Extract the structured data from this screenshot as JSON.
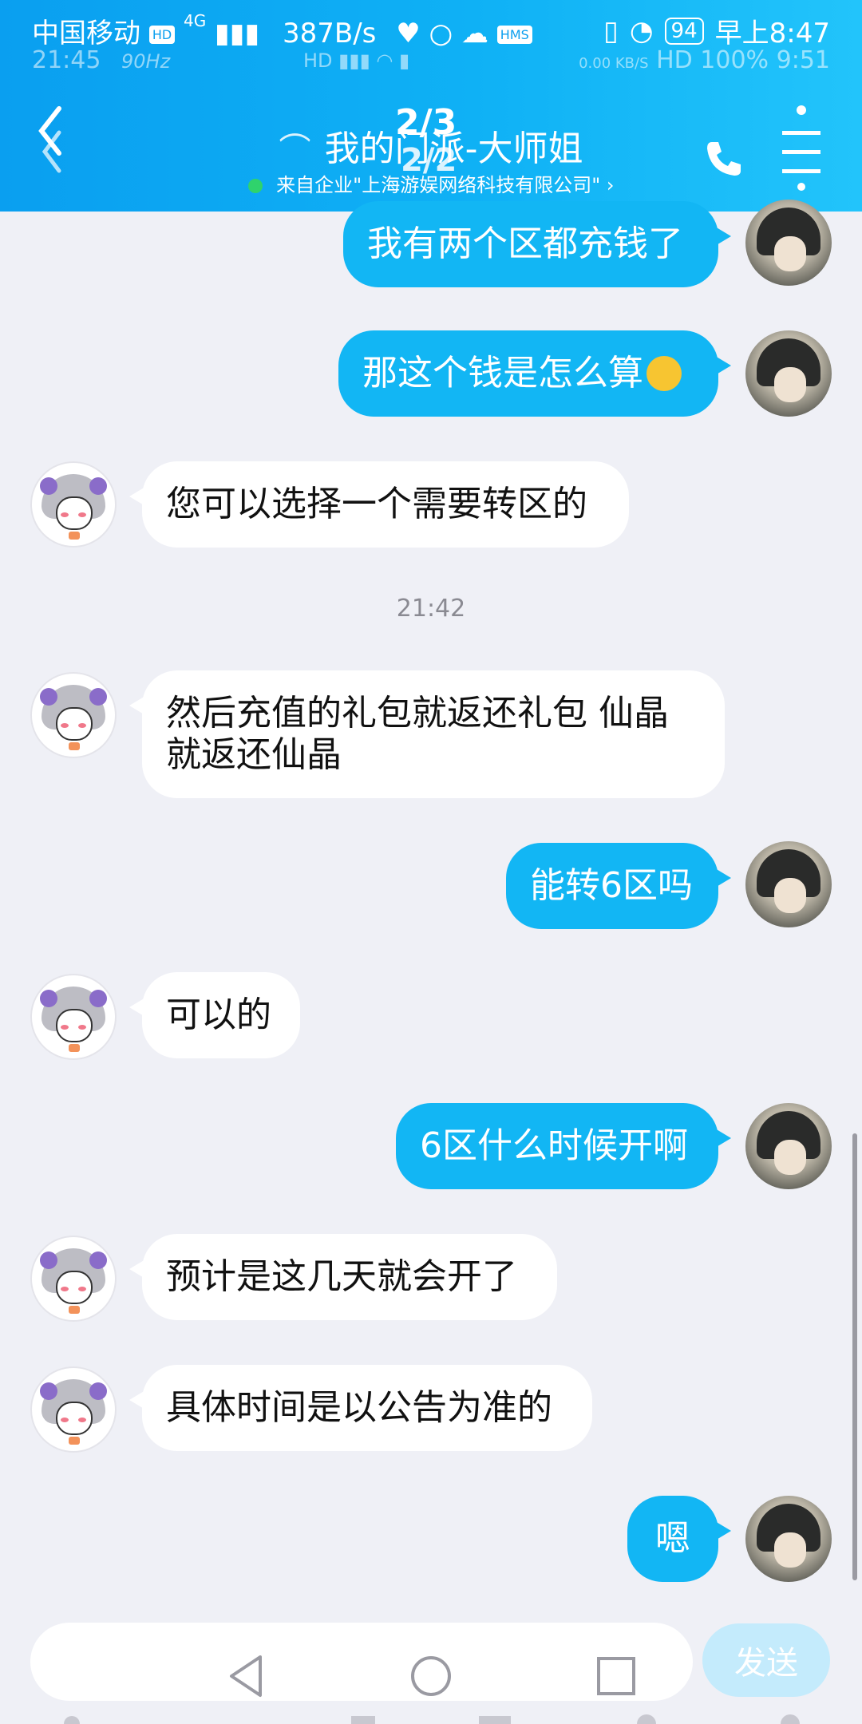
{
  "status_bar": {
    "carrier": "中国移动",
    "hd": "HD",
    "net": "4G",
    "speed": "387B/s",
    "battery": "94",
    "time": "早上8:47",
    "hms": "HMS"
  },
  "ghost_status_bar": {
    "time": "21:45",
    "hz": "90Hz",
    "speed": "0.00 KB/S",
    "hd": "HD",
    "battery": "100%",
    "clock": "9:51"
  },
  "header": {
    "title": "我的门派-大师姐",
    "subtitle": "来自企业\"上海游娱网络科技有限公司\" ›",
    "page_indicator": "2/3",
    "page_indicator_ghost": "2/2"
  },
  "messages": [
    {
      "side": "me",
      "text": "我有两个区都充钱了"
    },
    {
      "side": "me",
      "text": "那这个钱是怎么算",
      "emoji": "sneezing-face"
    },
    {
      "side": "cs",
      "text": "您可以选择一个需要转区的"
    },
    {
      "side": "cs",
      "text": "然后充值的礼包就返还礼包 仙晶就返还仙晶"
    },
    {
      "side": "me",
      "text": "能转6区吗"
    },
    {
      "side": "cs",
      "text": "可以的"
    },
    {
      "side": "me",
      "text": "6区什么时候开啊"
    },
    {
      "side": "cs",
      "text": "预计是这几天就会开了"
    },
    {
      "side": "cs",
      "text": "具体时间是以公告为准的"
    },
    {
      "side": "me",
      "text": "嗯"
    }
  ],
  "timestamp": "21:42",
  "input": {
    "placeholder": "",
    "send_label": "发送"
  },
  "colors": {
    "header": "#0fb1f5",
    "my_bubble": "#12b6f4",
    "background": "#eff0f6"
  }
}
